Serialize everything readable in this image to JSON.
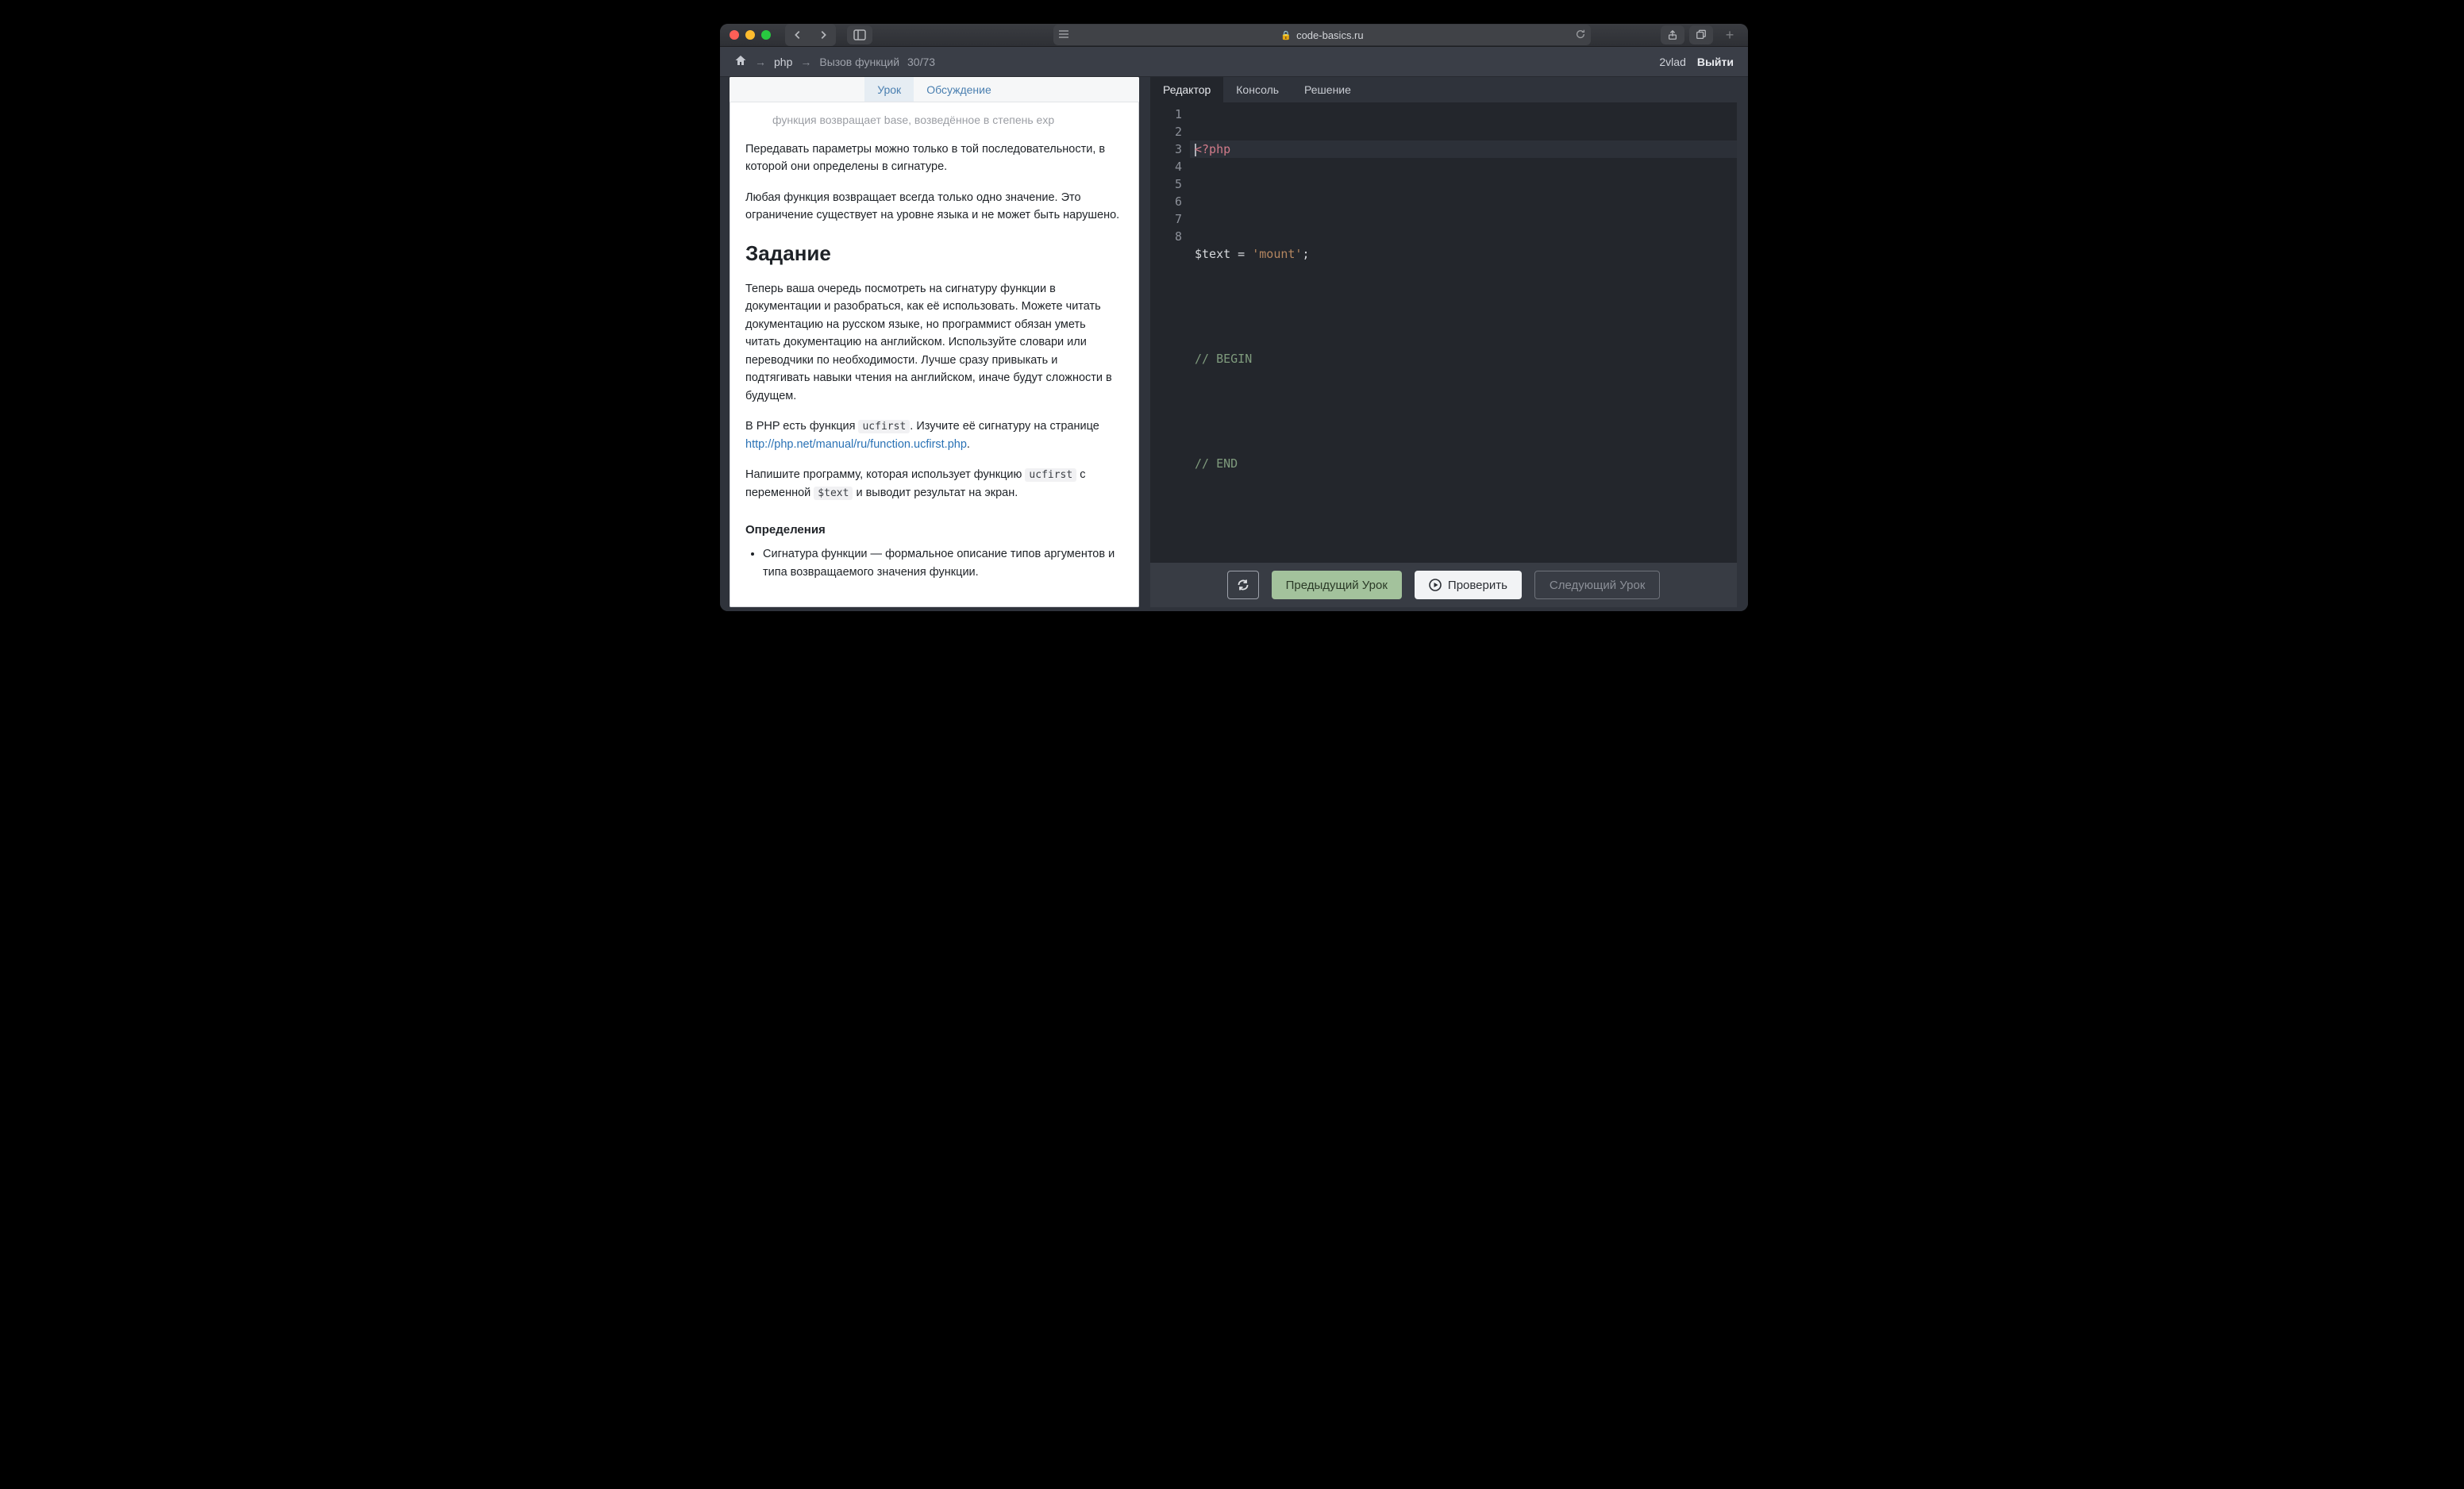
{
  "browser": {
    "url_host": "code-basics.ru"
  },
  "header": {
    "lang": "php",
    "lesson_title": "Вызов функций",
    "lesson_counter": "30/73",
    "username": "2vlad",
    "logout": "Выйти"
  },
  "lesson_tabs": {
    "lesson": "Урок",
    "discussion": "Обсуждение"
  },
  "lesson_content": {
    "truncated_line": "функция возвращает base, возведённое в степень exp",
    "p1": "Передавать параметры можно только в той последовательности, в которой они определены в сигнатуре.",
    "p2": "Любая функция возвращает всегда только одно значение. Это ограничение существует на уровне языка и не может быть нарушено.",
    "task_heading": "Задание",
    "p3": "Теперь ваша очередь посмотреть на сигнатуру функции в документации и разобраться, как её использовать. Можете читать документацию на русском языке, но программист обязан уметь читать документацию на английском. Используйте словари или переводчики по необходимости. Лучше сразу привыкать и подтягивать навыки чтения на английском, иначе будут сложности в будущем.",
    "p4_a": "В PHP есть функция ",
    "code_ucfirst": "ucfirst",
    "p4_b": ". Изучите её сигнатуру на странице ",
    "doc_link_text": "http://php.net/manual/ru/function.ucfirst.php",
    "p4_c": ".",
    "p5_a": "Напишите программу, которая использует функцию ",
    "p5_b": " с переменной ",
    "code_text": "$text",
    "p5_c": " и выводит результат на экран.",
    "defs_heading": "Определения",
    "def1": "Сигнатура функции — формальное описание типов аргументов и типа возвращаемого значения функции."
  },
  "editor_tabs": {
    "editor": "Редактор",
    "console": "Консоль",
    "solution": "Решение"
  },
  "code": {
    "l1_tag": "<?php",
    "l3_var": "$text",
    "l3_eq": " = ",
    "l3_str": "'mount'",
    "l3_semi": ";",
    "l5": "// BEGIN",
    "l7": "// END"
  },
  "actions": {
    "prev": "Предыдущий Урок",
    "check": "Проверить",
    "next": "Следующий Урок"
  }
}
